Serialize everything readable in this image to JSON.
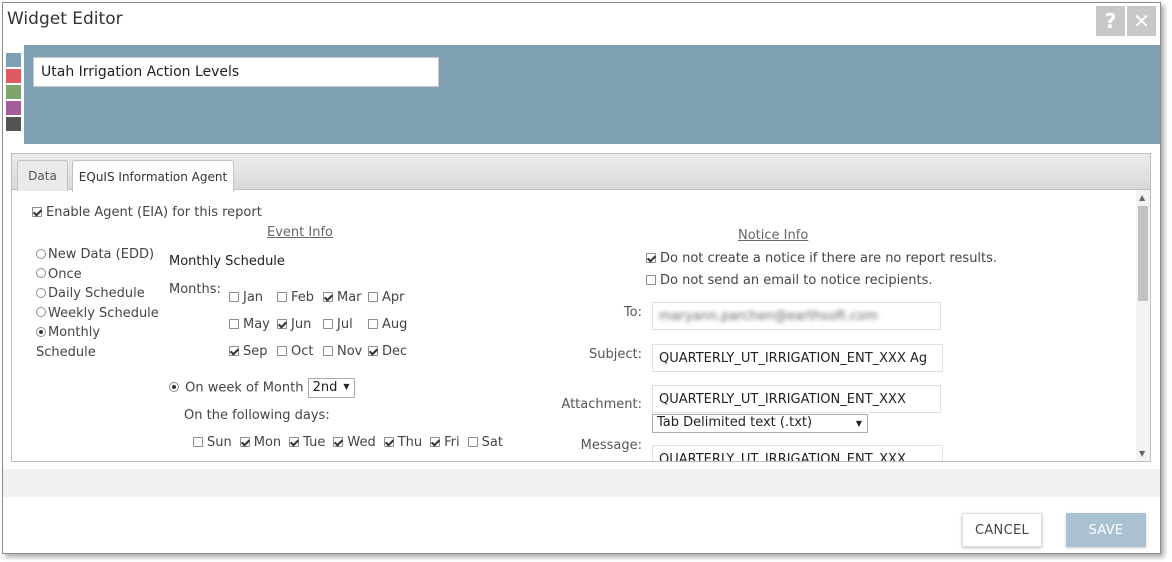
{
  "window": {
    "title": "Widget Editor",
    "help_glyph": "?",
    "close_glyph": "✕"
  },
  "header": {
    "widget_name": "Utah Irrigation Action Levels",
    "swatch_colors": [
      "#7f9fb3",
      "#e05a64",
      "#7fa56d",
      "#a25d9a",
      "#545454"
    ]
  },
  "tabs": {
    "data": "Data",
    "eia": "EQuIS Information Agent"
  },
  "eia": {
    "enable_label": "Enable Agent (EIA) for this report",
    "enabled": true
  },
  "event_info": {
    "heading": "Event Info",
    "schedule_types": [
      {
        "label": "New Data (EDD)",
        "selected": false
      },
      {
        "label": "Once",
        "selected": false
      },
      {
        "label": "Daily Schedule",
        "selected": false
      },
      {
        "label": "Weekly Schedule",
        "selected": false
      },
      {
        "label": "Monthly Schedule",
        "selected": true
      }
    ],
    "monthly_heading": "Monthly Schedule",
    "months_label": "Months:",
    "months": [
      {
        "label": "Jan",
        "checked": false
      },
      {
        "label": "Feb",
        "checked": false
      },
      {
        "label": "Mar",
        "checked": true
      },
      {
        "label": "Apr",
        "checked": false
      },
      {
        "label": "May",
        "checked": false
      },
      {
        "label": "Jun",
        "checked": true
      },
      {
        "label": "Jul",
        "checked": false
      },
      {
        "label": "Aug",
        "checked": false
      },
      {
        "label": "Sep",
        "checked": true
      },
      {
        "label": "Oct",
        "checked": false
      },
      {
        "label": "Nov",
        "checked": false
      },
      {
        "label": "Dec",
        "checked": true
      }
    ],
    "week_of_month_label": "On week of Month",
    "week_of_month_selected": true,
    "week_value": "2nd",
    "following_days_label": "On the following days:",
    "days": [
      {
        "label": "Sun",
        "checked": false
      },
      {
        "label": "Mon",
        "checked": true
      },
      {
        "label": "Tue",
        "checked": true
      },
      {
        "label": "Wed",
        "checked": true
      },
      {
        "label": "Thu",
        "checked": true
      },
      {
        "label": "Fri",
        "checked": true
      },
      {
        "label": "Sat",
        "checked": false
      }
    ]
  },
  "notice_info": {
    "heading": "Notice Info",
    "no_notice_label": "Do not create a notice if there are no report results.",
    "no_notice_checked": true,
    "no_email_label": "Do not send an email to notice recipients.",
    "no_email_checked": false,
    "to_label": "To:",
    "to_value": "maryann.parchen@earthsoft.com",
    "subject_label": "Subject:",
    "subject_value": "QUARTERLY_UT_IRRIGATION_ENT_XXX Ag",
    "attachment_label": "Attachment:",
    "attachment_value": "QUARTERLY_UT_IRRIGATION_ENT_XXX",
    "attachment_format": "Tab Delimited text (.txt)",
    "message_label": "Message:",
    "message_value": "QUARTERLY_UT_IRRIGATION_ENT_XXX"
  },
  "footer": {
    "cancel_label": "CANCEL",
    "save_label": "SAVE"
  }
}
